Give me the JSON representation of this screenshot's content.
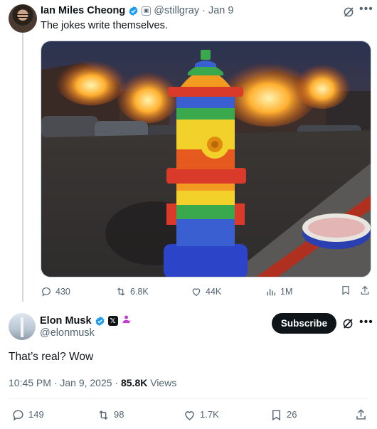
{
  "parent_tweet": {
    "author_name": "Ian Miles Cheong",
    "handle": "@stillgray",
    "separator": "·",
    "date": "Jan 9",
    "text": "The jokes write themselves.",
    "image_alt": "Rainbow-striped fire hydrant in front of burning houses",
    "actions": {
      "replies": "430",
      "reposts": "6.8K",
      "likes": "44K",
      "views": "1M"
    }
  },
  "main_tweet": {
    "author_name": "Elon Musk",
    "handle": "@elonmusk",
    "subscribe_label": "Subscribe",
    "text": "That’s real? Wow",
    "timestamp": "10:45 PM · Jan 9, 2025 · ",
    "views_count": "85.8K",
    "views_label": " Views",
    "actions": {
      "replies": "149",
      "reposts": "98",
      "likes": "1.7K",
      "bookmarks": "26"
    }
  },
  "colors": {
    "verified_blue": "#1d9bf0",
    "muted_text": "#536471",
    "primary_text": "#0f1419",
    "affiliate_purple": "#c13fd0"
  },
  "icons": {
    "reply": "reply-icon",
    "repost": "repost-icon",
    "like": "heart-icon",
    "views": "analytics-icon",
    "bookmark": "bookmark-icon",
    "share": "share-icon",
    "grok": "grok-icon",
    "more": "more-icon"
  }
}
